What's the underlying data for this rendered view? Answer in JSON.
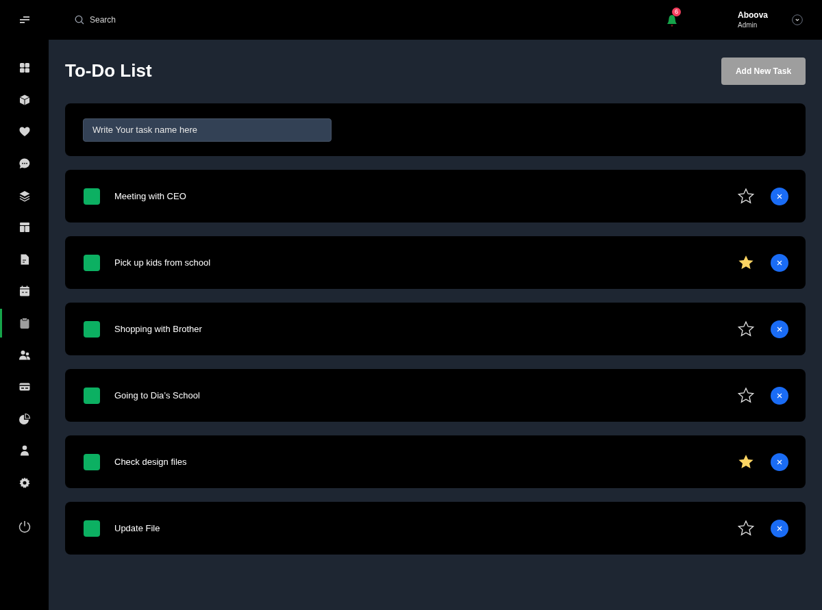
{
  "topbar": {
    "search": {
      "placeholder": "Search"
    },
    "notifications": {
      "count": "6"
    },
    "user": {
      "name": "Aboova",
      "role": "Admin"
    }
  },
  "sidebar": {
    "items": [
      {
        "selected": false
      },
      {
        "selected": false
      },
      {
        "selected": false
      },
      {
        "selected": false
      },
      {
        "selected": false
      },
      {
        "selected": false
      },
      {
        "selected": false
      },
      {
        "selected": false
      },
      {
        "selected": true
      },
      {
        "selected": false
      },
      {
        "selected": false
      },
      {
        "selected": false
      },
      {
        "selected": false
      },
      {
        "selected": false
      }
    ]
  },
  "page": {
    "title": "To-Do List",
    "add_button": "Add New Task",
    "new_task": {
      "placeholder": "Write Your task name here"
    }
  },
  "tasks": [
    {
      "name": "Meeting with CEO",
      "checked": true,
      "starred": false
    },
    {
      "name": "Pick up kids from school",
      "checked": true,
      "starred": true
    },
    {
      "name": "Shopping with Brother",
      "checked": true,
      "starred": false
    },
    {
      "name": "Going to Dia’s School",
      "checked": true,
      "starred": false
    },
    {
      "name": "Check design files",
      "checked": true,
      "starred": true
    },
    {
      "name": "Update File",
      "checked": true,
      "starred": false
    }
  ]
}
